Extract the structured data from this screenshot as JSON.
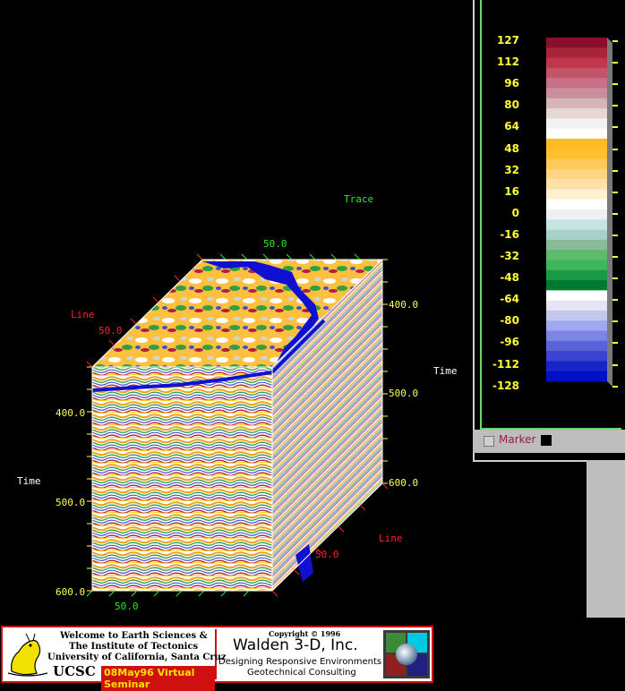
{
  "axes": {
    "trace_title": "Trace",
    "trace_tick": "50.0",
    "line_title_left": "Line",
    "line_tick_left": "50.0",
    "line_title_right": "Line",
    "line_tick_right": "50.0",
    "time_title_left": "Time",
    "time_title_right": "Time",
    "time_ticks_left": [
      "400.0",
      "500.0",
      "600.0"
    ],
    "time_ticks_right": [
      "400.0",
      "500.0",
      "600.0"
    ],
    "bottom_tick": "50.0"
  },
  "colorbar": {
    "ticks": [
      "127",
      "112",
      "96",
      "80",
      "64",
      "48",
      "32",
      "16",
      "0",
      "-16",
      "-32",
      "-48",
      "-64",
      "-80",
      "-96",
      "-112",
      "-128"
    ],
    "bands": [
      "#8a0f2a",
      "#a8243a",
      "#c0374d",
      "#c45468",
      "#c8708a",
      "#c9909b",
      "#d6b5b8",
      "#e6d6d6",
      "#f2f2f2",
      "#ffffff",
      "#ffbb22",
      "#ffc030",
      "#ffc85a",
      "#ffd584",
      "#ffe0a8",
      "#fff0d0",
      "#ffffff",
      "#f0f0f0",
      "#c5e5e5",
      "#a8d2c8",
      "#88bb98",
      "#5cbb6c",
      "#3fb65c",
      "#1b9a46",
      "#007a30",
      "#ffffff",
      "#e4e4f4",
      "#c4c8ef",
      "#a0a8ef",
      "#7c84e4",
      "#5a64d8",
      "#3a44d0",
      "#1624c8",
      "#0010c4"
    ]
  },
  "marker": {
    "label": "Marker"
  },
  "banner": {
    "left_line1": "Welcome to Earth Sciences &",
    "left_line2": "The Institute of Tectonics",
    "left_line3": "University of California, Santa Cruz",
    "ucsc": "UCSC",
    "seminar": "08May96 Virtual Seminar",
    "copyright": "Copyright © 1996",
    "company": "Walden 3-D, Inc.",
    "tagline1": "Designing Responsive Environments",
    "tagline2": "Geotechnical Consulting"
  }
}
